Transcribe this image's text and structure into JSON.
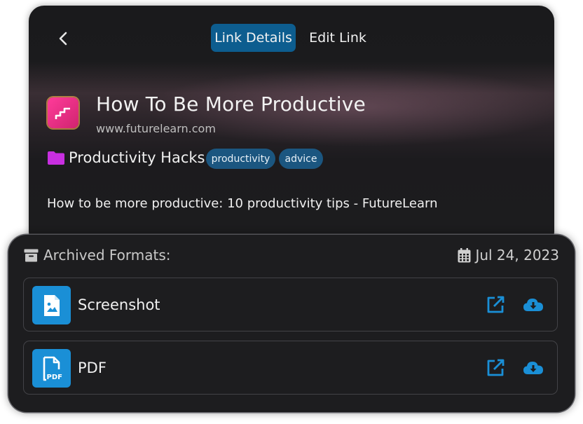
{
  "tabs": {
    "details": "Link Details",
    "edit": "Edit Link"
  },
  "link": {
    "title": "How To Be More Productive",
    "url": "www.futurelearn.com",
    "collection": "Productivity Hacks",
    "tags": [
      "productivity",
      "advice"
    ],
    "description": "How to be more productive: 10 productivity tips - FutureLearn"
  },
  "archive": {
    "heading": "Archived Formats:",
    "date": "Jul 24, 2023",
    "formats": [
      {
        "label": "Screenshot",
        "icon": "image-file-icon"
      },
      {
        "label": "PDF",
        "icon": "pdf-file-icon",
        "badge": "PDF"
      }
    ]
  },
  "colors": {
    "accent": "#1a8fd6",
    "active_tab": "#0d5d8f",
    "tag_bg": "#1b5680",
    "folder": "#c82fe0",
    "site_icon": "#ff3b9a"
  }
}
